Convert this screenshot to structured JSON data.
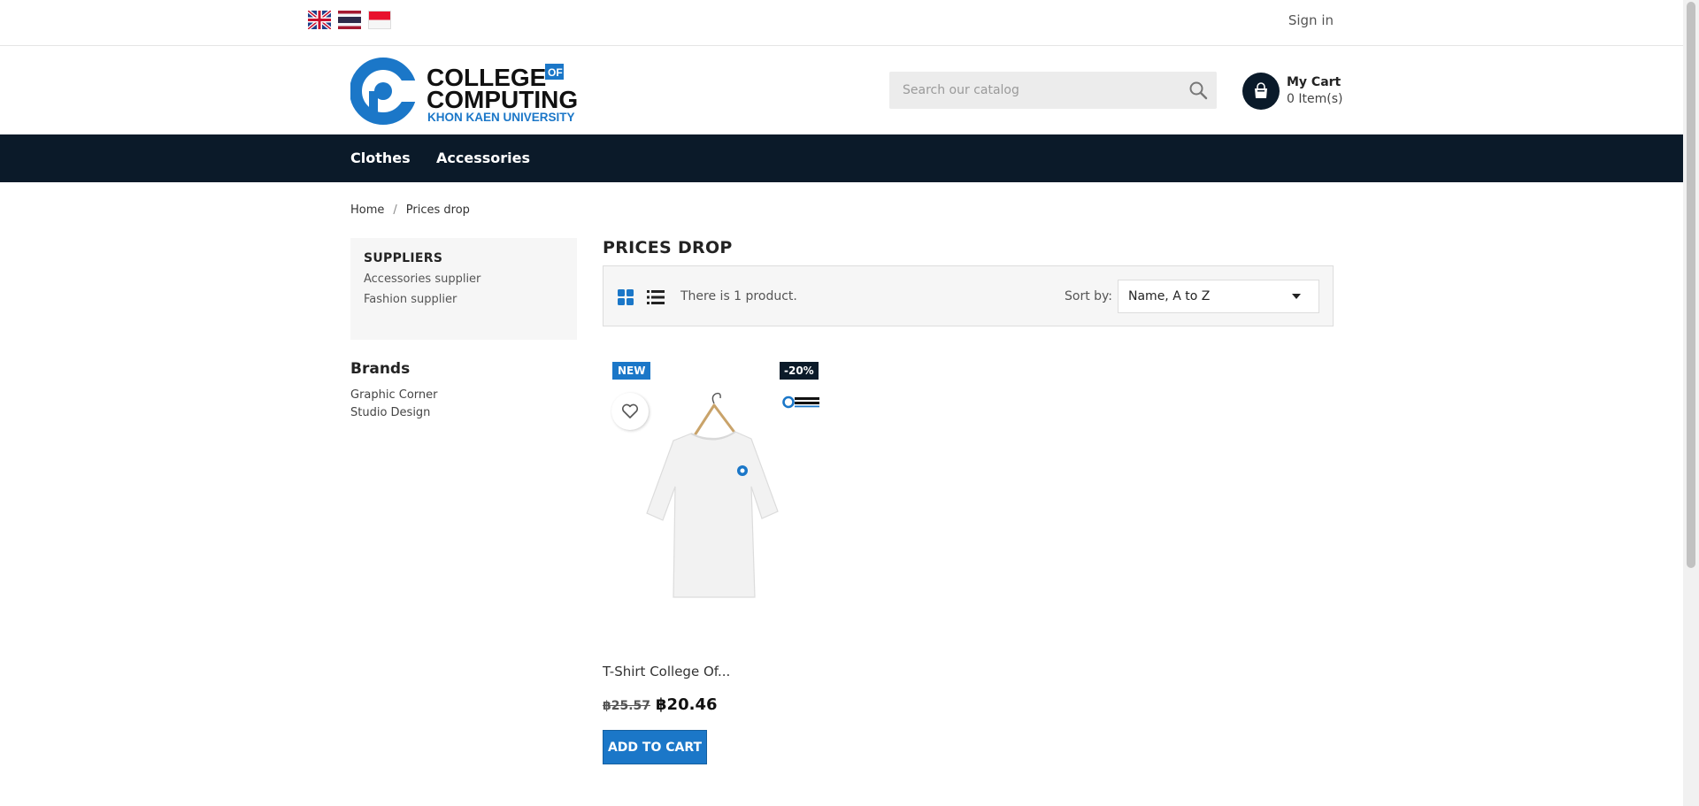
{
  "topbar": {
    "languages": [
      "english-flag-icon",
      "thai-flag-icon",
      "indonesian-flag-icon"
    ],
    "signin_label": "Sign in"
  },
  "header": {
    "logo": {
      "line1": "COLLEGE",
      "of": "OF",
      "line2": "COMPUTING",
      "line3": "KHON KAEN UNIVERSITY"
    },
    "search": {
      "placeholder": "Search our catalog",
      "value": ""
    },
    "cart": {
      "title": "My Cart",
      "count": "0 Item(s)"
    }
  },
  "nav": {
    "items": [
      "Clothes",
      "Accessories"
    ]
  },
  "breadcrumb": {
    "items": [
      "Home",
      "Prices drop"
    ],
    "separator": "/"
  },
  "sidebar": {
    "suppliers": {
      "title": "SUPPLIERS",
      "items": [
        "Accessories supplier",
        "Fashion supplier"
      ]
    },
    "brands": {
      "title": "Brands",
      "items": [
        "Graphic Corner",
        "Studio Design"
      ]
    }
  },
  "main": {
    "title": "PRICES DROP",
    "total_products": "There is 1 product.",
    "sort_label": "Sort by:",
    "sort_value": "Name, A to Z",
    "products": [
      {
        "badge_new": "NEW",
        "badge_discount": "-20%",
        "name": "T-Shirt College Of...",
        "old_price": "฿25.57",
        "new_price": "฿20.46",
        "add_to_cart": "ADD TO CART"
      }
    ]
  },
  "colors": {
    "nav_bg": "#0b1a29",
    "accent": "#1b77c8",
    "logo_blue": "#1b77c8"
  }
}
